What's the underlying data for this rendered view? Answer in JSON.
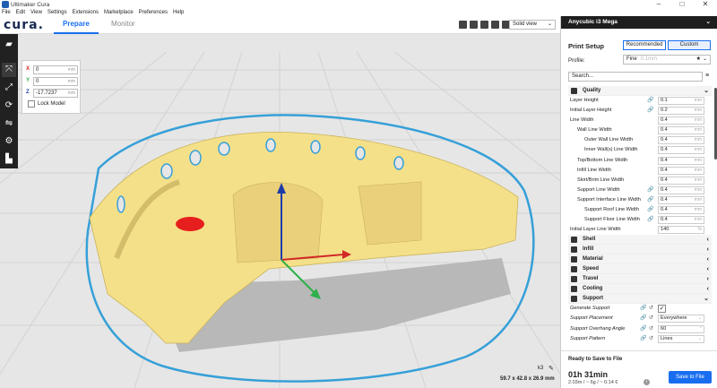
{
  "window": {
    "title": "Ultimaker Cura"
  },
  "menu": [
    "File",
    "Edit",
    "View",
    "Settings",
    "Extensions",
    "Marketplace",
    "Preferences",
    "Help"
  ],
  "header": {
    "logo": "cura.",
    "tabs": [
      "Prepare",
      "Monitor"
    ],
    "active_tab": "Prepare",
    "view_select": "Solid view"
  },
  "move_panel": {
    "x": "0",
    "y": "0",
    "z": "-17.7237",
    "unit": "mm",
    "lock_model": "Lock Model"
  },
  "object": {
    "name": "k3",
    "dimensions": "59.7 x 42.8 x 26.9 mm"
  },
  "printer": {
    "name": "Anycubic i3 Mega"
  },
  "print_setup": {
    "title": "Print Setup",
    "modes": [
      "Recommended",
      "Custom"
    ],
    "active_mode": "Custom",
    "profile_label": "Profile:",
    "profile_value": "Fine",
    "profile_sub": "0.1mm",
    "search_placeholder": "Search..."
  },
  "settings": {
    "quality_label": "Quality",
    "quality_rows": [
      {
        "label": "Layer Height",
        "value": "0.1",
        "unit": "mm",
        "indent": 0,
        "link": true
      },
      {
        "label": "Initial Layer Height",
        "value": "0.2",
        "unit": "mm",
        "indent": 0,
        "link": true
      },
      {
        "label": "Line Width",
        "value": "0.4",
        "unit": "mm",
        "indent": 0,
        "link": false
      },
      {
        "label": "Wall Line Width",
        "value": "0.4",
        "unit": "mm",
        "indent": 1,
        "link": false
      },
      {
        "label": "Outer Wall Line Width",
        "value": "0.4",
        "unit": "mm",
        "indent": 2,
        "link": false
      },
      {
        "label": "Inner Wall(s) Line Width",
        "value": "0.4",
        "unit": "mm",
        "indent": 2,
        "link": false
      },
      {
        "label": "Top/Bottom Line Width",
        "value": "0.4",
        "unit": "mm",
        "indent": 1,
        "link": false
      },
      {
        "label": "Infill Line Width",
        "value": "0.4",
        "unit": "mm",
        "indent": 1,
        "link": false
      },
      {
        "label": "Skirt/Brim Line Width",
        "value": "0.4",
        "unit": "mm",
        "indent": 1,
        "link": false
      },
      {
        "label": "Support Line Width",
        "value": "0.4",
        "unit": "mm",
        "indent": 1,
        "link": true
      },
      {
        "label": "Support Interface Line Width",
        "value": "0.4",
        "unit": "mm",
        "indent": 1,
        "link": true
      },
      {
        "label": "Support Roof Line Width",
        "value": "0.4",
        "unit": "mm",
        "indent": 2,
        "link": true
      },
      {
        "label": "Support Floor Line Width",
        "value": "0.4",
        "unit": "mm",
        "indent": 2,
        "link": true
      },
      {
        "label": "Initial Layer Line Width",
        "value": "140",
        "unit": "%",
        "indent": 0,
        "link": false
      }
    ],
    "categories": [
      "Shell",
      "Infill",
      "Material",
      "Speed",
      "Travel",
      "Cooling"
    ],
    "support_label": "Support",
    "support_rows": [
      {
        "label": "Generate Support",
        "type": "check",
        "value": "✓"
      },
      {
        "label": "Support Placement",
        "type": "select",
        "value": "Everywhere"
      },
      {
        "label": "Support Overhang Angle",
        "type": "input",
        "value": "60",
        "unit": "°"
      },
      {
        "label": "Support Pattern",
        "type": "select",
        "value": "Lines"
      }
    ]
  },
  "output": {
    "status": "Ready to Save to File",
    "time": "01h 31min",
    "material": "2.03m / ~ 6g / ~ 0.14 €",
    "save_label": "Save to File"
  },
  "colors": {
    "accent": "#196ef0",
    "model": "#f5e08a",
    "outline": "#36a0d8"
  }
}
